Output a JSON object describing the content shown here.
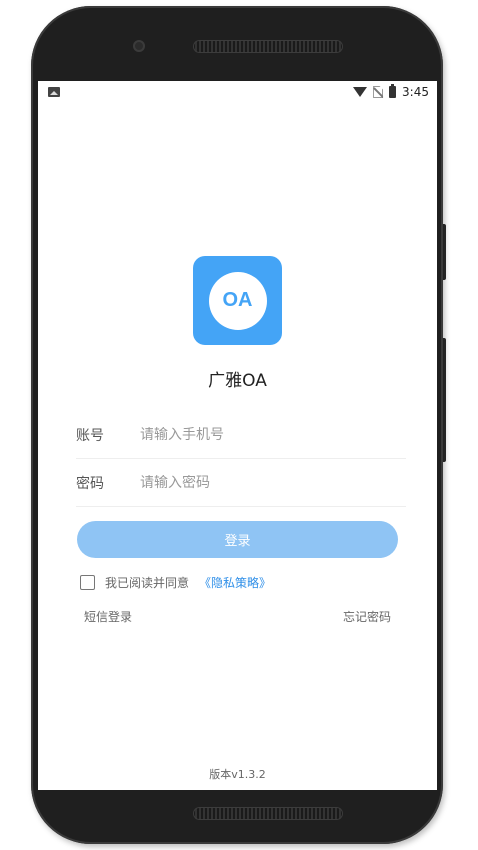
{
  "status_bar": {
    "time": "3:45",
    "icons": [
      "image-icon",
      "wifi-icon",
      "no-sim-icon",
      "battery-icon"
    ]
  },
  "app": {
    "logo_text": "OA",
    "name": "广雅OA",
    "brand_color": "#44a4f6"
  },
  "form": {
    "account": {
      "label": "账号",
      "placeholder": "请输入手机号",
      "value": ""
    },
    "password": {
      "label": "密码",
      "placeholder": "请输入密码",
      "value": ""
    },
    "login_label": "登录",
    "login_button_color": "#8fc4f4"
  },
  "agreement": {
    "checked": false,
    "text": "我已阅读并同意",
    "link_text": "《隐私策略》",
    "link_color": "#2f8fe8"
  },
  "links": {
    "sms_login": "短信登录",
    "forgot_password": "忘记密码"
  },
  "footer": {
    "version": "版本v1.3.2"
  }
}
